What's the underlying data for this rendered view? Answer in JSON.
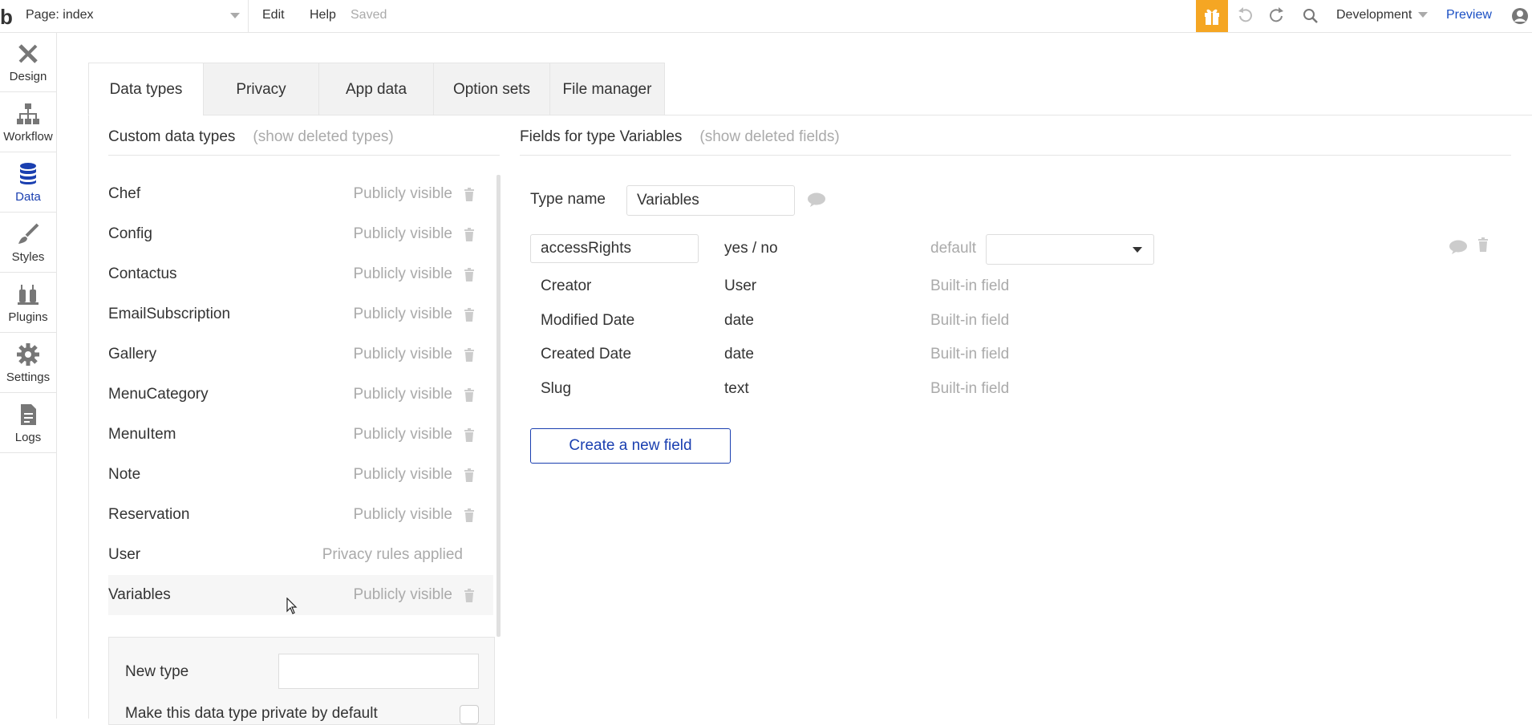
{
  "topbar": {
    "logo": "b",
    "page_select": "Page: index",
    "menu_edit": "Edit",
    "menu_help": "Help",
    "status": "Saved",
    "environment": "Development",
    "preview": "Preview",
    "icons": [
      "gift-icon",
      "undo-icon",
      "redo-icon",
      "search-icon",
      "user-account-icon"
    ]
  },
  "sidebar": {
    "items": [
      {
        "label": "Design",
        "icon": "design-icon"
      },
      {
        "label": "Workflow",
        "icon": "workflow-icon"
      },
      {
        "label": "Data",
        "icon": "database-icon",
        "active": true
      },
      {
        "label": "Styles",
        "icon": "brush-icon"
      },
      {
        "label": "Plugins",
        "icon": "plug-icon"
      },
      {
        "label": "Settings",
        "icon": "gear-icon"
      },
      {
        "label": "Logs",
        "icon": "document-icon"
      }
    ]
  },
  "tabs": [
    "Data types",
    "Privacy",
    "App data",
    "Option sets",
    "File manager"
  ],
  "custom_types": {
    "heading": "Custom data types",
    "show_deleted": "(show deleted types)",
    "rows": [
      {
        "name": "Chef",
        "visibility": "Publicly visible"
      },
      {
        "name": "Config",
        "visibility": "Publicly visible"
      },
      {
        "name": "Contactus",
        "visibility": "Publicly visible"
      },
      {
        "name": "EmailSubscription",
        "visibility": "Publicly visible"
      },
      {
        "name": "Gallery",
        "visibility": "Publicly visible"
      },
      {
        "name": "MenuCategory",
        "visibility": "Publicly visible"
      },
      {
        "name": "MenuItem",
        "visibility": "Publicly visible"
      },
      {
        "name": "Note",
        "visibility": "Publicly visible"
      },
      {
        "name": "Reservation",
        "visibility": "Publicly visible"
      },
      {
        "name": "User",
        "visibility": "Privacy rules applied"
      },
      {
        "name": "Variables",
        "visibility": "Publicly visible"
      }
    ],
    "new_type_label": "New type",
    "new_type_value": "",
    "private_label": "Make this data type private by default"
  },
  "fields": {
    "heading": "Fields for type Variables",
    "show_deleted": "(show deleted fields)",
    "type_name_label": "Type name",
    "type_name_value": "Variables",
    "editable_field": {
      "name": "accessRights",
      "type": "yes / no",
      "default_label": "default",
      "default_value": ""
    },
    "builtin": [
      {
        "name": "Creator",
        "type": "User",
        "note": "Built-in field"
      },
      {
        "name": "Modified Date",
        "type": "date",
        "note": "Built-in field"
      },
      {
        "name": "Created Date",
        "type": "date",
        "note": "Built-in field"
      },
      {
        "name": "Slug",
        "type": "text",
        "note": "Built-in field"
      }
    ],
    "create_button": "Create a new field"
  },
  "colors": {
    "accent_blue": "#1a3fb0",
    "link_blue": "#1a4fc4",
    "gift_orange": "#f5a623",
    "muted_text": "#aaaaaa"
  }
}
